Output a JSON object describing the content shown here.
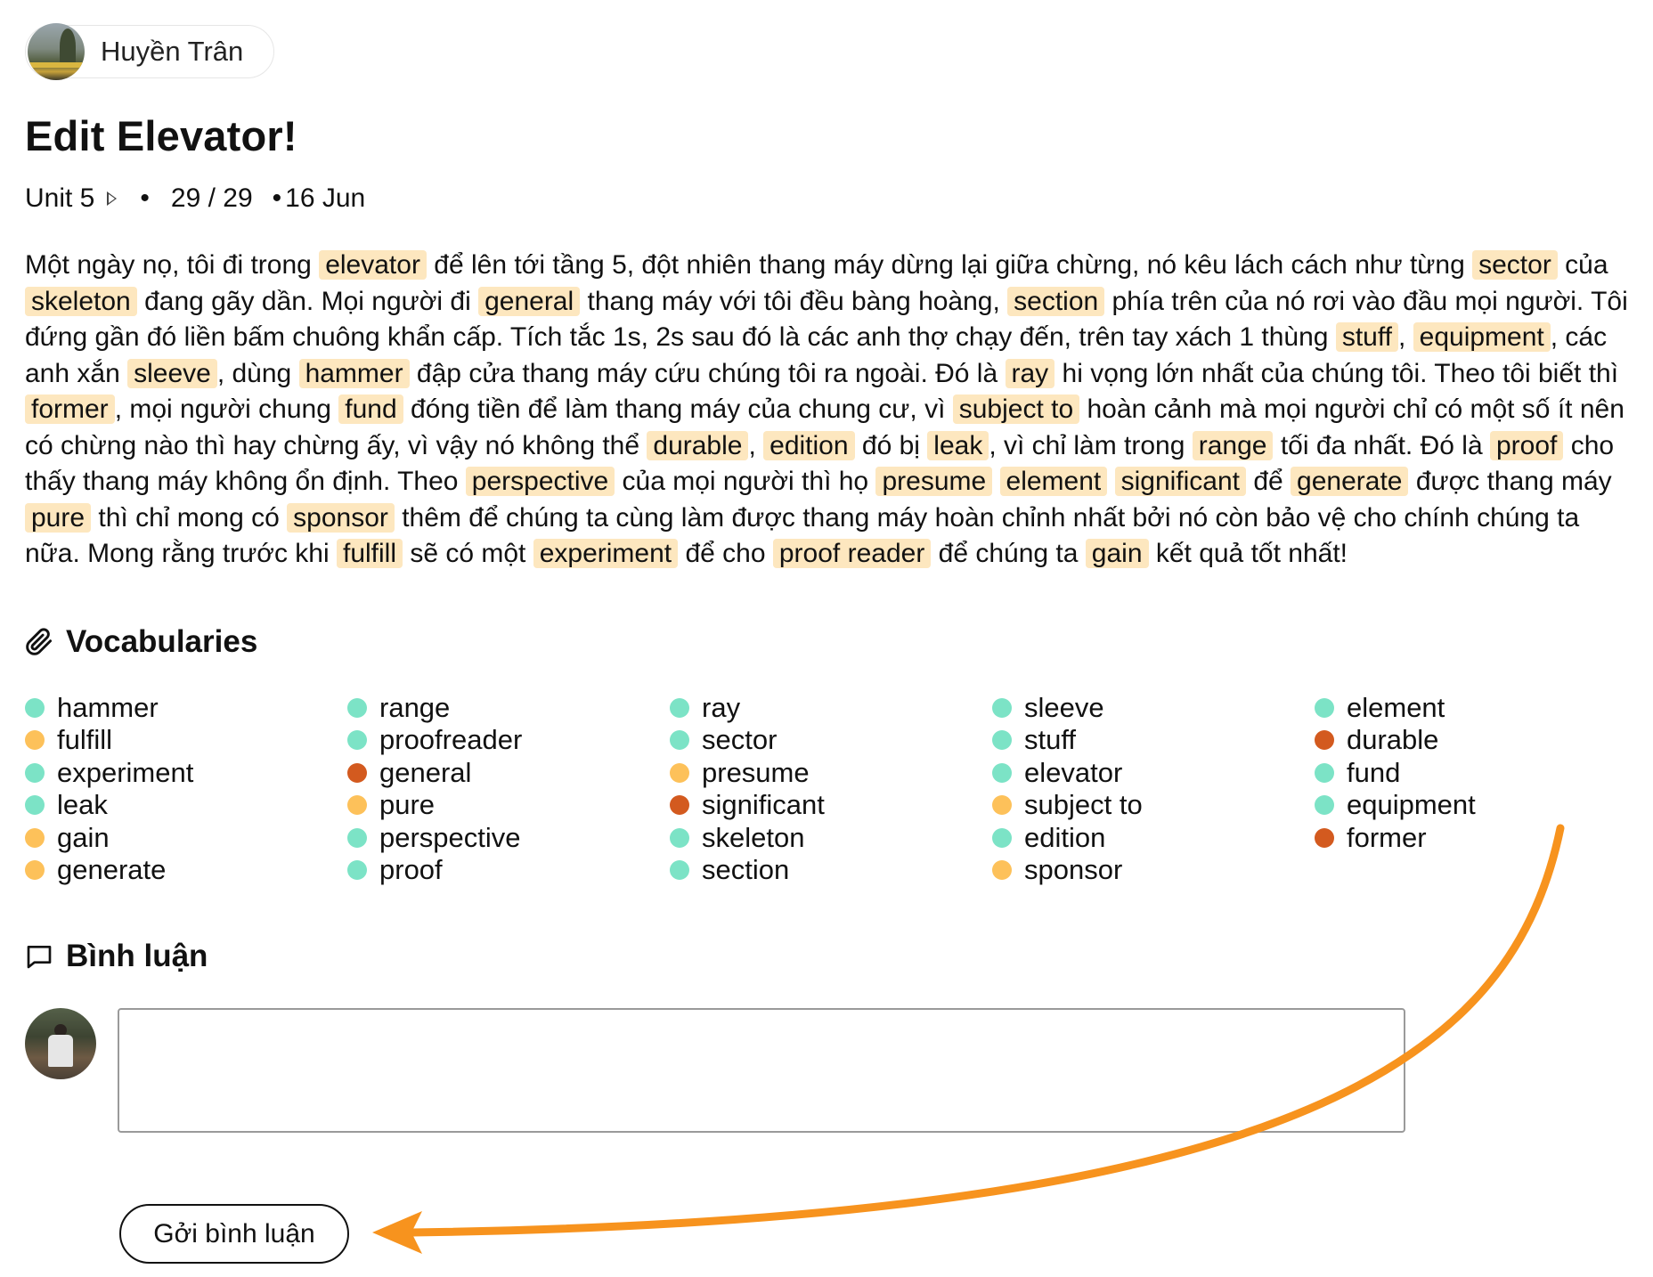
{
  "user": {
    "name": "Huyền Trân"
  },
  "page": {
    "title": "Edit Elevator!"
  },
  "meta": {
    "unit": "Unit 5",
    "progress": "29 / 29",
    "date": "16 Jun"
  },
  "story": [
    "Một ngày nọ, tôi đi trong ",
    {
      "w": "elevator"
    },
    " để lên tới tầng 5, đột nhiên thang máy dừng lại giữa chừng, nó kêu lách cách như từng ",
    {
      "w": "sector"
    },
    " của ",
    {
      "w": "skeleton"
    },
    " đang gãy dần. Mọi người đi ",
    {
      "w": "general"
    },
    " thang máy với tôi đều bàng hoàng, ",
    {
      "w": "section"
    },
    " phía trên của nó rơi vào đầu mọi người. Tôi đứng gần đó liền bấm chuông khẩn cấp. Tích tắc 1s, 2s sau đó là các anh thợ chạy đến, trên tay xách 1 thùng ",
    {
      "w": "stuff"
    },
    ", ",
    {
      "w": "equipment"
    },
    ", các anh xắn ",
    {
      "w": "sleeve"
    },
    ", dùng ",
    {
      "w": "hammer"
    },
    " đập cửa thang máy cứu chúng tôi ra ngoài. Đó là ",
    {
      "w": "ray"
    },
    " hi vọng lớn nhất của chúng tôi. Theo tôi biết thì ",
    {
      "w": "former"
    },
    ", mọi người chung ",
    {
      "w": "fund"
    },
    " đóng tiền để làm thang máy của chung cư, vì ",
    {
      "w": "subject to"
    },
    " hoàn cảnh mà mọi người chỉ có một số ít nên có chừng nào thì hay chừng ấy, vì vậy nó không thể ",
    {
      "w": "durable"
    },
    ", ",
    {
      "w": "edition"
    },
    " đó bị ",
    {
      "w": "leak"
    },
    ", vì chỉ làm trong ",
    {
      "w": "range"
    },
    " tối đa nhất. Đó là ",
    {
      "w": "proof"
    },
    " cho thấy thang máy không ổn định. Theo ",
    {
      "w": "perspective"
    },
    " của mọi người thì họ ",
    {
      "w": "presume"
    },
    " ",
    {
      "w": "element"
    },
    " ",
    {
      "w": "significant"
    },
    " để ",
    {
      "w": "generate"
    },
    " được thang máy ",
    {
      "w": "pure"
    },
    " thì chỉ mong có ",
    {
      "w": "sponsor"
    },
    " thêm để chúng ta cùng làm được thang máy hoàn chỉnh nhất bởi nó còn bảo vệ cho chính chúng ta nữa. Mong rằng trước khi ",
    {
      "w": "fulfill"
    },
    " sẽ có một ",
    {
      "w": "experiment"
    },
    " để cho ",
    {
      "w": "proof reader"
    },
    " để chúng ta ",
    {
      "w": "gain"
    },
    " kết quả tốt nhất!"
  ],
  "vocab": {
    "heading": "Vocabularies",
    "colors": {
      "green": "#7ce3c6",
      "yellow": "#fdc15a",
      "red": "#d35a1f"
    },
    "columns": [
      [
        {
          "w": "hammer",
          "c": "green"
        },
        {
          "w": "fulfill",
          "c": "yellow"
        },
        {
          "w": "experiment",
          "c": "green"
        },
        {
          "w": "leak",
          "c": "green"
        },
        {
          "w": "gain",
          "c": "yellow"
        },
        {
          "w": "generate",
          "c": "yellow"
        }
      ],
      [
        {
          "w": "range",
          "c": "green"
        },
        {
          "w": "proofreader",
          "c": "green"
        },
        {
          "w": "general",
          "c": "red"
        },
        {
          "w": "pure",
          "c": "yellow"
        },
        {
          "w": "perspective",
          "c": "green"
        },
        {
          "w": "proof",
          "c": "green"
        }
      ],
      [
        {
          "w": "ray",
          "c": "green"
        },
        {
          "w": "sector",
          "c": "green"
        },
        {
          "w": "presume",
          "c": "yellow"
        },
        {
          "w": "significant",
          "c": "red"
        },
        {
          "w": "skeleton",
          "c": "green"
        },
        {
          "w": "section",
          "c": "green"
        }
      ],
      [
        {
          "w": "sleeve",
          "c": "green"
        },
        {
          "w": "stuff",
          "c": "green"
        },
        {
          "w": "elevator",
          "c": "green"
        },
        {
          "w": "subject to",
          "c": "yellow"
        },
        {
          "w": "edition",
          "c": "green"
        },
        {
          "w": "sponsor",
          "c": "yellow"
        }
      ],
      [
        {
          "w": "element",
          "c": "green"
        },
        {
          "w": "durable",
          "c": "red"
        },
        {
          "w": "fund",
          "c": "green"
        },
        {
          "w": "equipment",
          "c": "green"
        },
        {
          "w": "former",
          "c": "red"
        }
      ]
    ]
  },
  "comments": {
    "heading": "Bình luận",
    "input_value": "",
    "submit_label": "Gởi bình luận"
  },
  "annotation": {
    "arrow_color": "#f7931e"
  }
}
